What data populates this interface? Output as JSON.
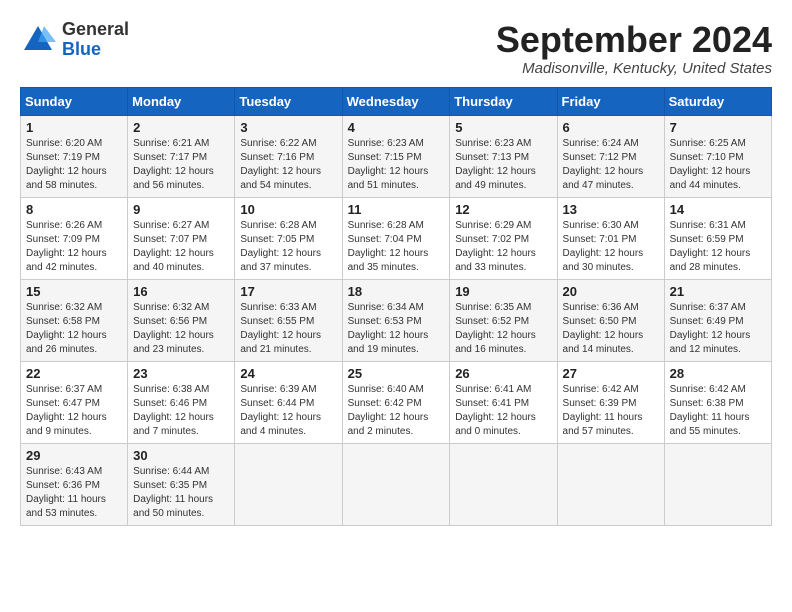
{
  "logo": {
    "general": "General",
    "blue": "Blue"
  },
  "title": "September 2024",
  "location": "Madisonville, Kentucky, United States",
  "headers": [
    "Sunday",
    "Monday",
    "Tuesday",
    "Wednesday",
    "Thursday",
    "Friday",
    "Saturday"
  ],
  "weeks": [
    [
      {
        "day": "1",
        "detail": "Sunrise: 6:20 AM\nSunset: 7:19 PM\nDaylight: 12 hours\nand 58 minutes."
      },
      {
        "day": "2",
        "detail": "Sunrise: 6:21 AM\nSunset: 7:17 PM\nDaylight: 12 hours\nand 56 minutes."
      },
      {
        "day": "3",
        "detail": "Sunrise: 6:22 AM\nSunset: 7:16 PM\nDaylight: 12 hours\nand 54 minutes."
      },
      {
        "day": "4",
        "detail": "Sunrise: 6:23 AM\nSunset: 7:15 PM\nDaylight: 12 hours\nand 51 minutes."
      },
      {
        "day": "5",
        "detail": "Sunrise: 6:23 AM\nSunset: 7:13 PM\nDaylight: 12 hours\nand 49 minutes."
      },
      {
        "day": "6",
        "detail": "Sunrise: 6:24 AM\nSunset: 7:12 PM\nDaylight: 12 hours\nand 47 minutes."
      },
      {
        "day": "7",
        "detail": "Sunrise: 6:25 AM\nSunset: 7:10 PM\nDaylight: 12 hours\nand 44 minutes."
      }
    ],
    [
      {
        "day": "8",
        "detail": "Sunrise: 6:26 AM\nSunset: 7:09 PM\nDaylight: 12 hours\nand 42 minutes."
      },
      {
        "day": "9",
        "detail": "Sunrise: 6:27 AM\nSunset: 7:07 PM\nDaylight: 12 hours\nand 40 minutes."
      },
      {
        "day": "10",
        "detail": "Sunrise: 6:28 AM\nSunset: 7:05 PM\nDaylight: 12 hours\nand 37 minutes."
      },
      {
        "day": "11",
        "detail": "Sunrise: 6:28 AM\nSunset: 7:04 PM\nDaylight: 12 hours\nand 35 minutes."
      },
      {
        "day": "12",
        "detail": "Sunrise: 6:29 AM\nSunset: 7:02 PM\nDaylight: 12 hours\nand 33 minutes."
      },
      {
        "day": "13",
        "detail": "Sunrise: 6:30 AM\nSunset: 7:01 PM\nDaylight: 12 hours\nand 30 minutes."
      },
      {
        "day": "14",
        "detail": "Sunrise: 6:31 AM\nSunset: 6:59 PM\nDaylight: 12 hours\nand 28 minutes."
      }
    ],
    [
      {
        "day": "15",
        "detail": "Sunrise: 6:32 AM\nSunset: 6:58 PM\nDaylight: 12 hours\nand 26 minutes."
      },
      {
        "day": "16",
        "detail": "Sunrise: 6:32 AM\nSunset: 6:56 PM\nDaylight: 12 hours\nand 23 minutes."
      },
      {
        "day": "17",
        "detail": "Sunrise: 6:33 AM\nSunset: 6:55 PM\nDaylight: 12 hours\nand 21 minutes."
      },
      {
        "day": "18",
        "detail": "Sunrise: 6:34 AM\nSunset: 6:53 PM\nDaylight: 12 hours\nand 19 minutes."
      },
      {
        "day": "19",
        "detail": "Sunrise: 6:35 AM\nSunset: 6:52 PM\nDaylight: 12 hours\nand 16 minutes."
      },
      {
        "day": "20",
        "detail": "Sunrise: 6:36 AM\nSunset: 6:50 PM\nDaylight: 12 hours\nand 14 minutes."
      },
      {
        "day": "21",
        "detail": "Sunrise: 6:37 AM\nSunset: 6:49 PM\nDaylight: 12 hours\nand 12 minutes."
      }
    ],
    [
      {
        "day": "22",
        "detail": "Sunrise: 6:37 AM\nSunset: 6:47 PM\nDaylight: 12 hours\nand 9 minutes."
      },
      {
        "day": "23",
        "detail": "Sunrise: 6:38 AM\nSunset: 6:46 PM\nDaylight: 12 hours\nand 7 minutes."
      },
      {
        "day": "24",
        "detail": "Sunrise: 6:39 AM\nSunset: 6:44 PM\nDaylight: 12 hours\nand 4 minutes."
      },
      {
        "day": "25",
        "detail": "Sunrise: 6:40 AM\nSunset: 6:42 PM\nDaylight: 12 hours\nand 2 minutes."
      },
      {
        "day": "26",
        "detail": "Sunrise: 6:41 AM\nSunset: 6:41 PM\nDaylight: 12 hours\nand 0 minutes."
      },
      {
        "day": "27",
        "detail": "Sunrise: 6:42 AM\nSunset: 6:39 PM\nDaylight: 11 hours\nand 57 minutes."
      },
      {
        "day": "28",
        "detail": "Sunrise: 6:42 AM\nSunset: 6:38 PM\nDaylight: 11 hours\nand 55 minutes."
      }
    ],
    [
      {
        "day": "29",
        "detail": "Sunrise: 6:43 AM\nSunset: 6:36 PM\nDaylight: 11 hours\nand 53 minutes."
      },
      {
        "day": "30",
        "detail": "Sunrise: 6:44 AM\nSunset: 6:35 PM\nDaylight: 11 hours\nand 50 minutes."
      },
      {
        "day": "",
        "detail": ""
      },
      {
        "day": "",
        "detail": ""
      },
      {
        "day": "",
        "detail": ""
      },
      {
        "day": "",
        "detail": ""
      },
      {
        "day": "",
        "detail": ""
      }
    ]
  ]
}
